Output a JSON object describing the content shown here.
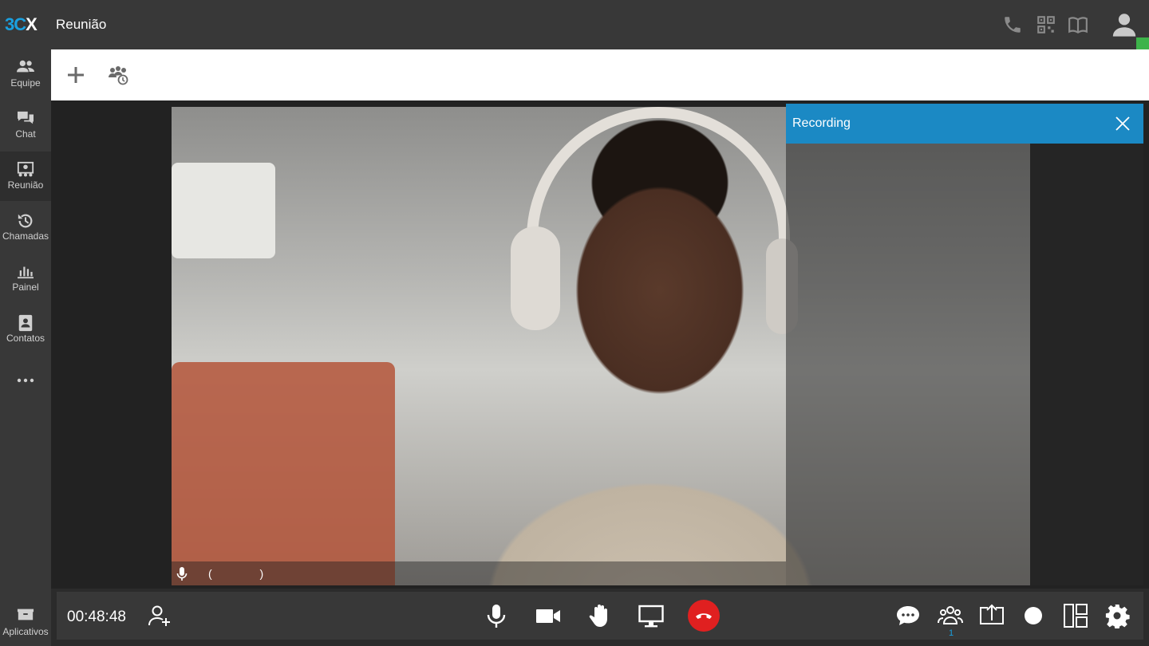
{
  "app": {
    "logo_3": "3",
    "logo_c": "C",
    "logo_x": "X",
    "title": "Reunião"
  },
  "sidebar": {
    "items": [
      {
        "label": "Equipe",
        "icon": "team-icon"
      },
      {
        "label": "Chat",
        "icon": "chat-icon"
      },
      {
        "label": "Reunião",
        "icon": "meeting-icon",
        "active": true
      },
      {
        "label": "Chamadas",
        "icon": "history-icon"
      },
      {
        "label": "Painel",
        "icon": "panel-chart-icon"
      },
      {
        "label": "Contatos",
        "icon": "contacts-icon"
      },
      {
        "label": "",
        "icon": "more-dots-icon"
      }
    ],
    "apps_label": "Aplicativos"
  },
  "video": {
    "participant_name": "( )"
  },
  "recording": {
    "title": "Recording"
  },
  "controls": {
    "timer": "00:48:48",
    "participants_count": "1"
  },
  "colors": {
    "brand_blue": "#1aa0e0",
    "recording_header": "#1b89c4",
    "hangup_red": "#e02020",
    "presence_green": "#3db34a"
  }
}
